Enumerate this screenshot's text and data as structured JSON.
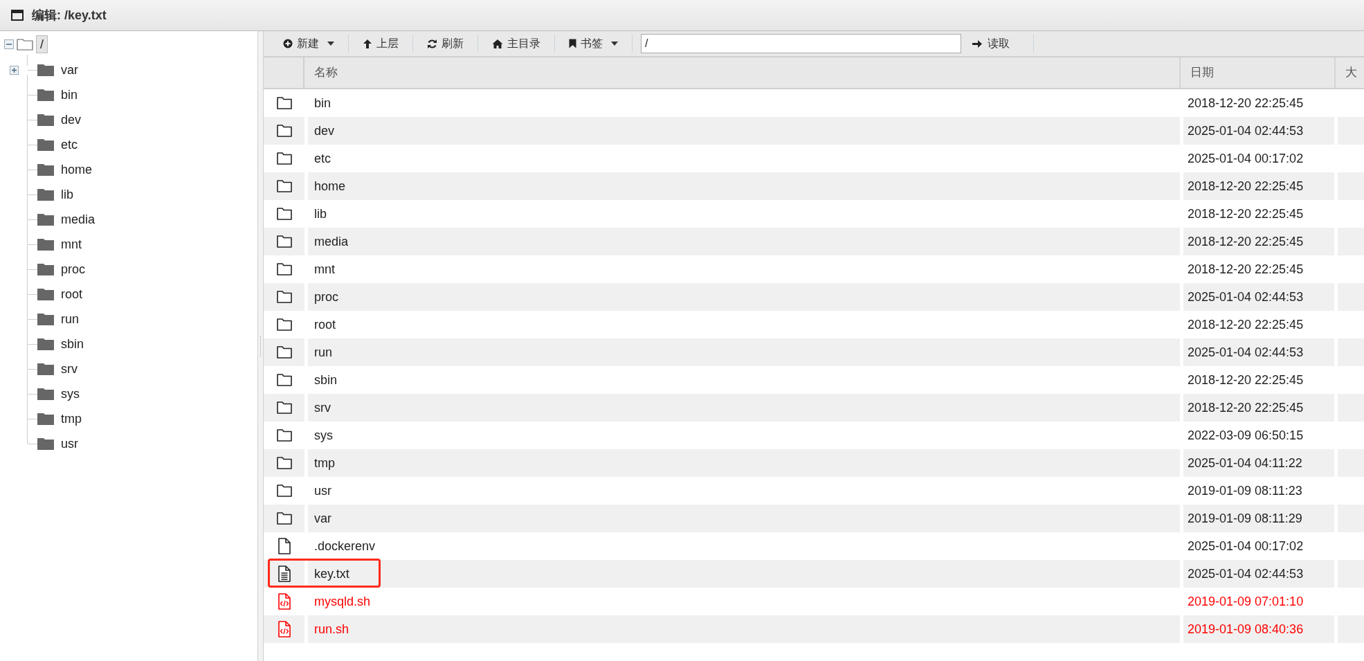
{
  "window": {
    "title": "编辑: /key.txt"
  },
  "tree": {
    "label": "/",
    "selected": true,
    "expanded": true,
    "children": [
      {
        "label": "var",
        "expandable": true
      },
      {
        "label": "bin",
        "expandable": false
      },
      {
        "label": "dev",
        "expandable": false
      },
      {
        "label": "etc",
        "expandable": false
      },
      {
        "label": "home",
        "expandable": false
      },
      {
        "label": "lib",
        "expandable": false
      },
      {
        "label": "media",
        "expandable": false
      },
      {
        "label": "mnt",
        "expandable": false
      },
      {
        "label": "proc",
        "expandable": false
      },
      {
        "label": "root",
        "expandable": false
      },
      {
        "label": "run",
        "expandable": false
      },
      {
        "label": "sbin",
        "expandable": false
      },
      {
        "label": "srv",
        "expandable": false
      },
      {
        "label": "sys",
        "expandable": false
      },
      {
        "label": "tmp",
        "expandable": false
      },
      {
        "label": "usr",
        "expandable": false
      }
    ]
  },
  "toolbar": {
    "buttons": [
      {
        "kind": "new",
        "label": "新建",
        "dropdown": true
      },
      {
        "kind": "up",
        "label": "上层",
        "dropdown": false
      },
      {
        "kind": "refresh",
        "label": "刷新",
        "dropdown": false
      },
      {
        "kind": "home",
        "label": "主目录",
        "dropdown": false
      },
      {
        "kind": "bookmark",
        "label": "书签",
        "dropdown": true
      }
    ],
    "path": "/",
    "read_button": "读取"
  },
  "table": {
    "columns": [
      "名称",
      "日期",
      "大"
    ],
    "rows": [
      {
        "kind": "folder",
        "name": "bin",
        "date": "2018-12-20 22:25:45",
        "highlighted": false
      },
      {
        "kind": "folder",
        "name": "dev",
        "date": "2025-01-04 02:44:53",
        "highlighted": false
      },
      {
        "kind": "folder",
        "name": "etc",
        "date": "2025-01-04 00:17:02",
        "highlighted": false
      },
      {
        "kind": "folder",
        "name": "home",
        "date": "2018-12-20 22:25:45",
        "highlighted": false
      },
      {
        "kind": "folder",
        "name": "lib",
        "date": "2018-12-20 22:25:45",
        "highlighted": false
      },
      {
        "kind": "folder",
        "name": "media",
        "date": "2018-12-20 22:25:45",
        "highlighted": false
      },
      {
        "kind": "folder",
        "name": "mnt",
        "date": "2018-12-20 22:25:45",
        "highlighted": false
      },
      {
        "kind": "folder",
        "name": "proc",
        "date": "2025-01-04 02:44:53",
        "highlighted": false
      },
      {
        "kind": "folder",
        "name": "root",
        "date": "2018-12-20 22:25:45",
        "highlighted": false
      },
      {
        "kind": "folder",
        "name": "run",
        "date": "2025-01-04 02:44:53",
        "highlighted": false
      },
      {
        "kind": "folder",
        "name": "sbin",
        "date": "2018-12-20 22:25:45",
        "highlighted": false
      },
      {
        "kind": "folder",
        "name": "srv",
        "date": "2018-12-20 22:25:45",
        "highlighted": false
      },
      {
        "kind": "folder",
        "name": "sys",
        "date": "2022-03-09 06:50:15",
        "highlighted": false
      },
      {
        "kind": "folder",
        "name": "tmp",
        "date": "2025-01-04 04:11:22",
        "highlighted": false
      },
      {
        "kind": "folder",
        "name": "usr",
        "date": "2019-01-09 08:11:23",
        "highlighted": false
      },
      {
        "kind": "folder",
        "name": "var",
        "date": "2019-01-09 08:11:29",
        "highlighted": false
      },
      {
        "kind": "file",
        "name": ".dockerenv",
        "date": "2025-01-04 00:17:02",
        "highlighted": false
      },
      {
        "kind": "text",
        "name": "key.txt",
        "date": "2025-01-04 02:44:53",
        "highlighted": true
      },
      {
        "kind": "script",
        "name": "mysqld.sh",
        "date": "2019-01-09 07:01:10",
        "highlighted": false
      },
      {
        "kind": "script",
        "name": "run.sh",
        "date": "2019-01-09 08:40:36",
        "highlighted": false
      }
    ]
  }
}
